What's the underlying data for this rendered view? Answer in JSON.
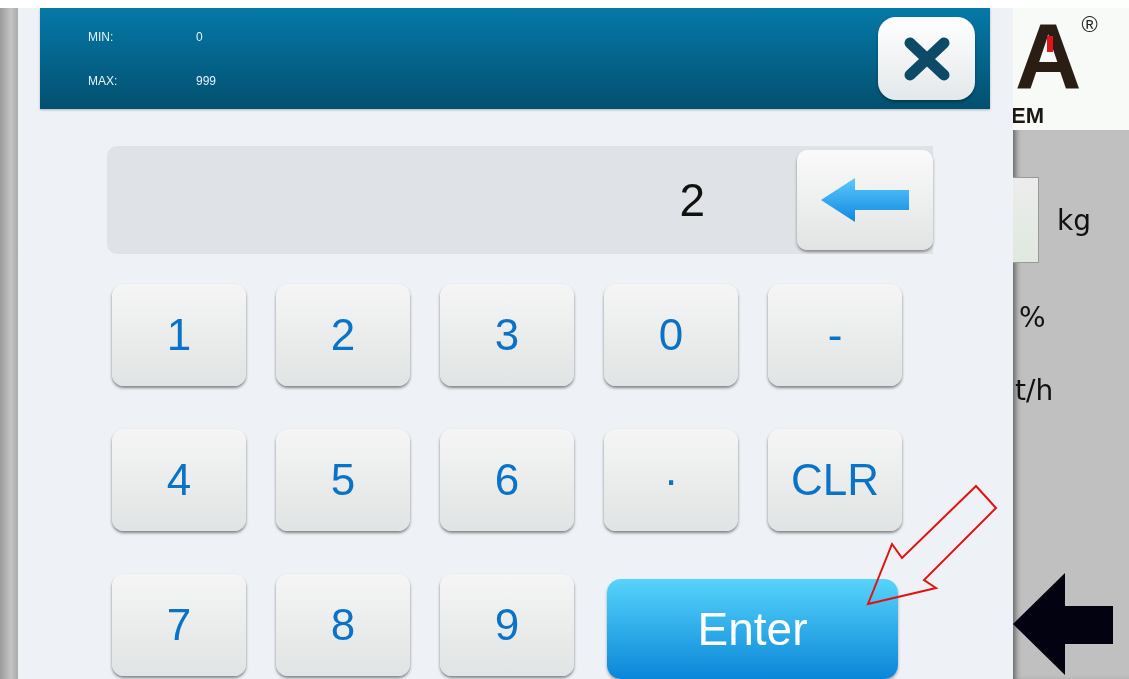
{
  "header": {
    "min_label": "MIN:",
    "min_value": "0",
    "max_label": "MAX:",
    "max_value": "999"
  },
  "display": {
    "value": "2"
  },
  "keys": [
    {
      "label": "1",
      "kind": "key"
    },
    {
      "label": "2",
      "kind": "key"
    },
    {
      "label": "3",
      "kind": "key"
    },
    {
      "label": "0",
      "kind": "key"
    },
    {
      "label": "-",
      "kind": "key"
    },
    {
      "label": "4",
      "kind": "key"
    },
    {
      "label": "5",
      "kind": "key"
    },
    {
      "label": "6",
      "kind": "key"
    },
    {
      "label": "·",
      "kind": "key"
    },
    {
      "label": "CLR",
      "kind": "key"
    },
    {
      "label": "7",
      "kind": "key"
    },
    {
      "label": "8",
      "kind": "key"
    },
    {
      "label": "9",
      "kind": "key"
    },
    {
      "label": "Enter",
      "kind": "enter"
    }
  ],
  "background": {
    "logo_letter": "A",
    "logo_mark": "®",
    "logo_subtext": "EM",
    "units": [
      {
        "unit": "kg",
        "kind": "field"
      },
      {
        "unit": "%",
        "kind": "text"
      },
      {
        "unit": "t/h",
        "kind": "text"
      }
    ]
  }
}
